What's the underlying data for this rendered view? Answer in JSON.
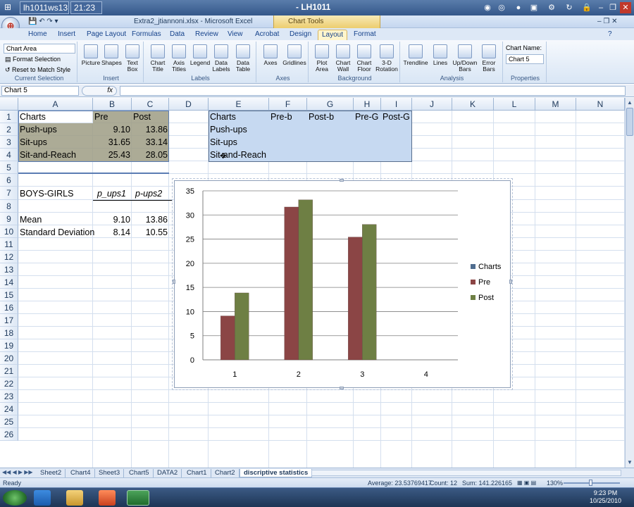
{
  "remote": {
    "host": "lh1011ws13",
    "time": "21:23",
    "session": "- LH1011"
  },
  "title": {
    "file": "Extra2_jtiannoni.xlsx - Microsoft Excel",
    "context_group": "Chart Tools"
  },
  "tabs": [
    "Home",
    "Insert",
    "Page Layout",
    "Formulas",
    "Data",
    "Review",
    "View",
    "Acrobat",
    "Design",
    "Layout",
    "Format"
  ],
  "active_tab": "Layout",
  "ribbon": {
    "current_selection": {
      "dropdown": "Chart Area",
      "format_selection": "Format Selection",
      "reset": "Reset to Match Style",
      "group": "Current Selection"
    },
    "insert": {
      "items": [
        "Picture",
        "Shapes",
        "Text Box"
      ],
      "group": "Insert"
    },
    "labels": {
      "items": [
        "Chart Title",
        "Axis Titles",
        "Legend",
        "Data Labels",
        "Data Table"
      ],
      "group": "Labels"
    },
    "axes": {
      "items": [
        "Axes",
        "Gridlines"
      ],
      "group": "Axes"
    },
    "background": {
      "items": [
        "Plot Area",
        "Chart Wall",
        "Chart Floor",
        "3-D Rotation"
      ],
      "group": "Background"
    },
    "analysis": {
      "items": [
        "Trendline",
        "Lines",
        "Up/Down Bars",
        "Error Bars"
      ],
      "group": "Analysis"
    },
    "properties": {
      "label": "Chart Name:",
      "value": "Chart 5",
      "group": "Properties"
    }
  },
  "formula_bar": {
    "name_box": "Chart 5",
    "fx": "fx"
  },
  "columns": [
    "A",
    "B",
    "C",
    "D",
    "E",
    "F",
    "G",
    "H",
    "I",
    "J",
    "K",
    "L",
    "M",
    "N"
  ],
  "rows": [
    "1",
    "2",
    "3",
    "4",
    "5",
    "6",
    "7",
    "8",
    "9",
    "10",
    "11",
    "12",
    "13",
    "14",
    "15",
    "16",
    "17",
    "18",
    "19",
    "20",
    "21",
    "22",
    "23",
    "24",
    "25",
    "26"
  ],
  "cells": {
    "A1": "Charts",
    "B1": "Pre",
    "C1": "Post",
    "A2": "Push-ups",
    "B2": "9.10",
    "C2": "13.86",
    "A3": "Sit-ups",
    "B3": "31.65",
    "C3": "33.14",
    "A4": "Sit-and-Reach",
    "B4": "25.43",
    "C4": "28.05",
    "A7": "BOYS-GIRLS",
    "B7": "p_ups1",
    "C7": "p-ups2",
    "A9": "Mean",
    "B9": "9.10",
    "C9": "13.86",
    "A10": "Standard Deviation",
    "B10": "8.14",
    "C10": "10.55",
    "E1": "Charts",
    "F1": "Pre-b",
    "G1": "Post-b",
    "H1": "Pre-G",
    "I1": "Post-G",
    "E2": "Push-ups",
    "E3": "Sit-ups",
    "E4": "Sit-and-Reach"
  },
  "chart_data": {
    "type": "bar",
    "categories": [
      "1",
      "2",
      "3",
      "4"
    ],
    "series": [
      {
        "name": "Charts",
        "values": [
          null,
          null,
          null,
          null
        ],
        "color": "#4f6d8f"
      },
      {
        "name": "Pre",
        "values": [
          9.1,
          31.65,
          25.43,
          null
        ],
        "color": "#8b4545"
      },
      {
        "name": "Post",
        "values": [
          13.86,
          33.14,
          28.05,
          null
        ],
        "color": "#6e7f44"
      }
    ],
    "ylim": [
      0,
      35
    ],
    "yticks": [
      0,
      5,
      10,
      15,
      20,
      25,
      30,
      35
    ],
    "grid": true,
    "legend": "right"
  },
  "sheets": [
    "Sheet2",
    "Chart4",
    "Sheet3",
    "Chart5",
    "DATA2",
    "Chart1",
    "Chart2",
    "discriptive statistics"
  ],
  "active_sheet": "discriptive statistics",
  "status": {
    "ready": "Ready",
    "average": "Average: 23.53769417",
    "count": "Count: 12",
    "sum": "Sum: 141.226165",
    "zoom": "130%"
  },
  "clock": {
    "time": "9:23 PM",
    "date": "10/25/2010"
  }
}
